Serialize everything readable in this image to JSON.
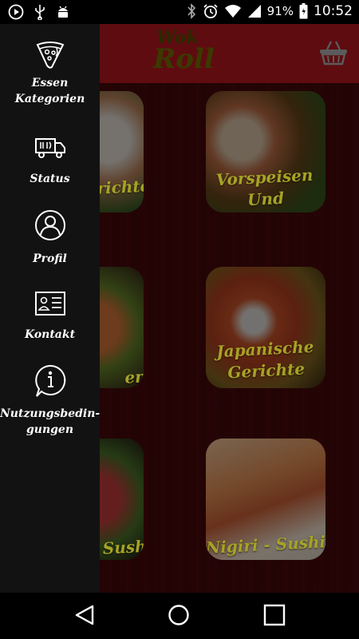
{
  "status_bar": {
    "battery_percent": "91%",
    "time": "10:52",
    "left_icons": [
      "play-icon",
      "usb-icon",
      "android-icon"
    ],
    "right_icons": [
      "bluetooth-icon",
      "alarm-icon",
      "wifi-icon",
      "signal-icon",
      "battery-icon"
    ]
  },
  "app_bar": {
    "logo_top": "Wok",
    "logo_bottom": "Roll",
    "cart_icon": "basket-icon"
  },
  "drawer": {
    "items": [
      {
        "label": "Essen\nKategorien",
        "icon": "pizza-icon"
      },
      {
        "label": "Status",
        "icon": "delivery-truck-icon"
      },
      {
        "label": "Profil",
        "icon": "user-icon"
      },
      {
        "label": "Kontakt",
        "icon": "contact-card-icon"
      },
      {
        "label": "Nutzungsbedin-\ngungen",
        "icon": "info-bubble-icon"
      }
    ]
  },
  "categories": [
    {
      "label": "Vorspeisen Und\nSalate"
    },
    {
      "label": "Japanische\nGerichte"
    },
    {
      "label": "Nigiri - Sushi"
    },
    {
      "label": "Gerichte"
    },
    {
      "label": "en"
    },
    {
      "label": "Sushi"
    }
  ],
  "colors": {
    "app_bar": "#5e0c0f",
    "drawer": "#121212",
    "tile_label": "#a6a326"
  }
}
